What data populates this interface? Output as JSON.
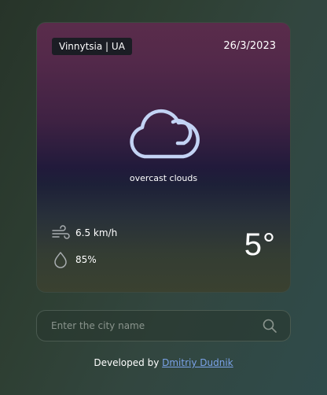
{
  "weather_card": {
    "location": "Vinnytsia | UA",
    "date": "26/3/2023",
    "icon": "cloud-icon",
    "description": "overcast clouds",
    "wind_icon": "wind-icon",
    "wind_speed": "6.5 km/h",
    "humidity_icon": "droplet-icon",
    "humidity": "85%",
    "temperature": "5°"
  },
  "search": {
    "placeholder": "Enter the city name",
    "icon": "search-icon"
  },
  "footer": {
    "prefix": "Developed by",
    "author_link": "Dmitriy Dudnik"
  },
  "colors": {
    "link": "#7aa2e8",
    "cloud_stroke": "#c3d3f4",
    "card_top": "#5a2c4b",
    "card_bottom": "#3a4130"
  }
}
